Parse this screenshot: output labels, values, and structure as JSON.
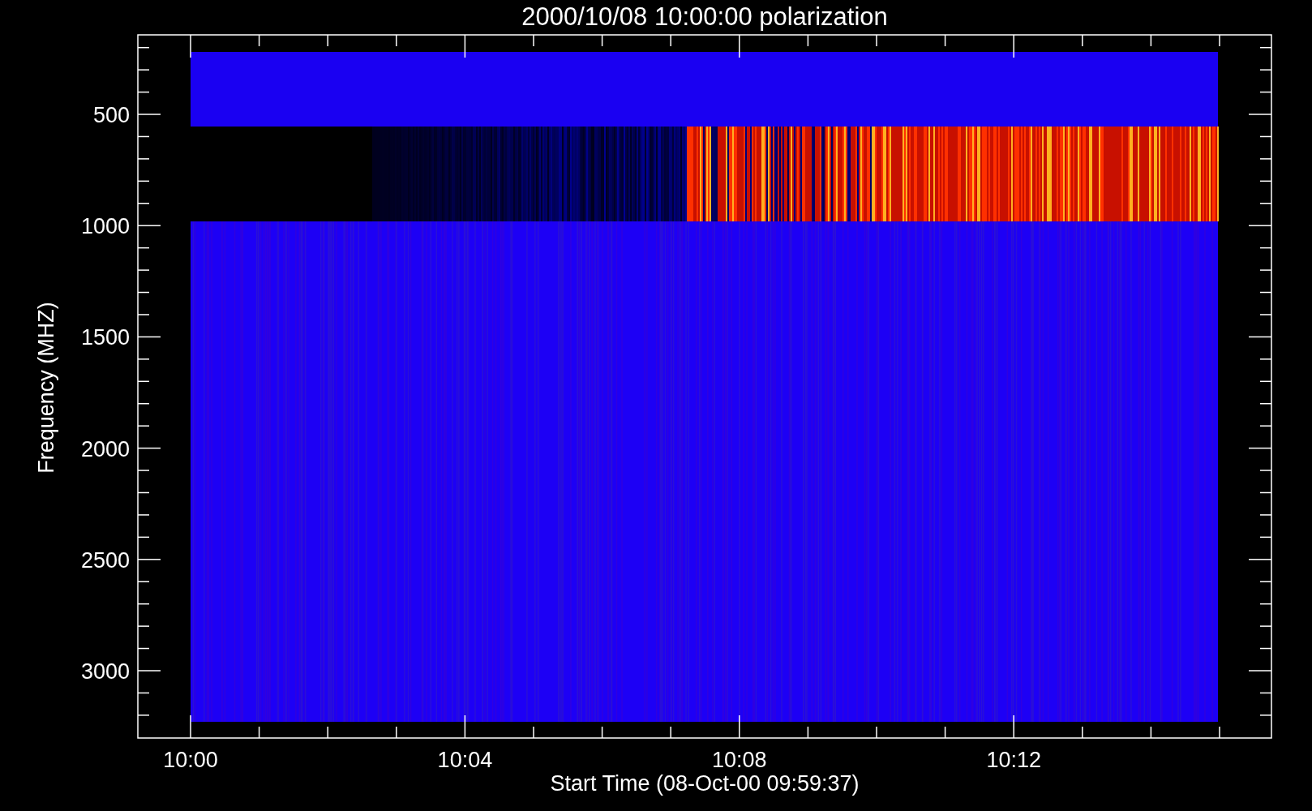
{
  "title": "2000/10/08 10:00:00 polarization",
  "xlabel": "Start Time (08-Oct-00 09:59:37)",
  "ylabel": "Frequency (MHZ)",
  "xticks": [
    "10:00",
    "10:04",
    "10:08",
    "10:12"
  ],
  "yticks": [
    "500",
    "1000",
    "1500",
    "2000",
    "2500",
    "3000"
  ]
}
